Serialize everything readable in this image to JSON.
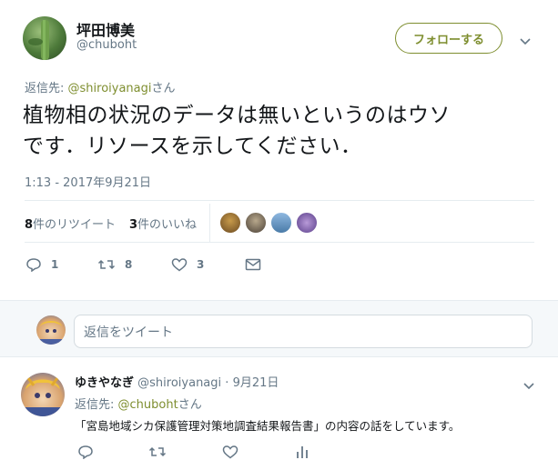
{
  "tweet": {
    "author_name": "坪田博美",
    "author_handle": "@chuboht",
    "follow_label": "フォローする",
    "reply_to_prefix": "返信先: ",
    "reply_to_handle": "@shiroiyanagi",
    "reply_to_suffix": "さん",
    "text_line1": "植物相の状況のデータは無いというのはウソ",
    "text_line2": "です．リソースを示してください．",
    "timestamp": "1:13 - 2017年9月21日",
    "retweet_count": "8",
    "retweet_label": "件のリツイート",
    "like_count": "3",
    "like_label": "件のいいね",
    "actions": {
      "reply_count": "1",
      "retweet_count": "8",
      "like_count": "3"
    }
  },
  "reply_input": {
    "placeholder": "返信をツイート"
  },
  "reply": {
    "author_name": "ゆきやなぎ",
    "author_handle": "@shiroiyanagi",
    "separator": "·",
    "date": "9月21日",
    "reply_to_prefix": "返信先: ",
    "reply_to_handle": "@chuboht",
    "reply_to_suffix": "さん",
    "text": "「宮島地域シカ保護管理対策地調査結果報告書」の内容の話をしています。"
  },
  "colors": {
    "accent": "#7e8e2f",
    "link": "#1da1f2",
    "muted": "#657786",
    "divider": "#e6ecf0"
  }
}
